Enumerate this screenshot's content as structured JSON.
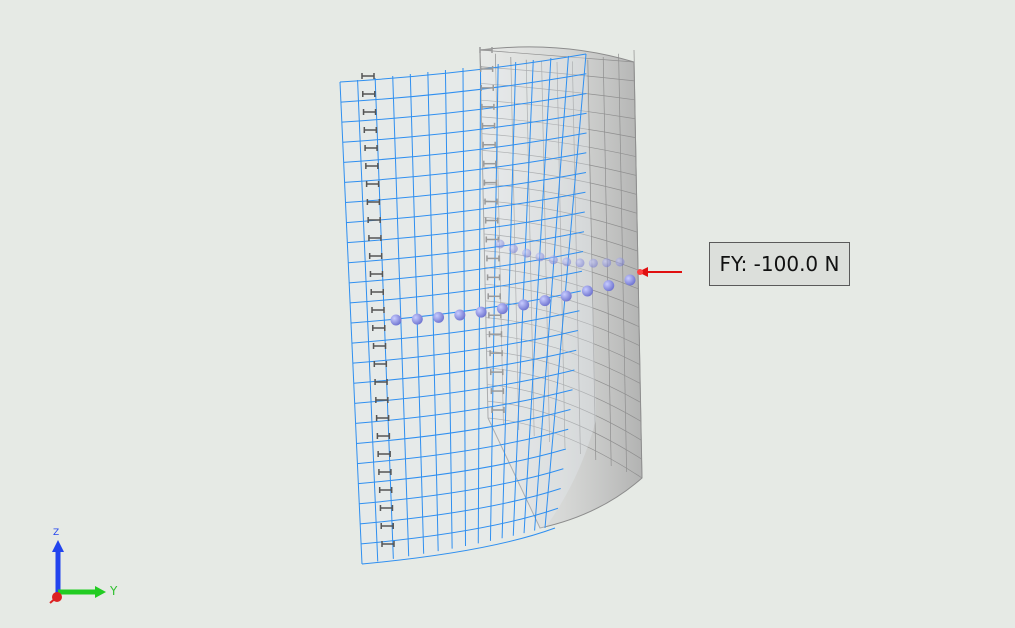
{
  "load_label": {
    "text": "FY: -100.0 N"
  },
  "axes": {
    "y_label": "Y",
    "z_label": "Z"
  },
  "icons": {
    "axis_triad": "xyz-axis-triad-icon",
    "support": "fixed-support-icon",
    "node": "node-sphere-icon",
    "load_arrow": "force-arrow-icon"
  },
  "colors": {
    "background": "#e6eae5",
    "mesh_selected": "#3399ff",
    "mesh_base": "#9a9a9a",
    "nodes": "#8a8fe0",
    "force": "#e01010",
    "axis_y": "#22cc22",
    "axis_z": "#2244ee",
    "axis_x": "#dd2222"
  }
}
